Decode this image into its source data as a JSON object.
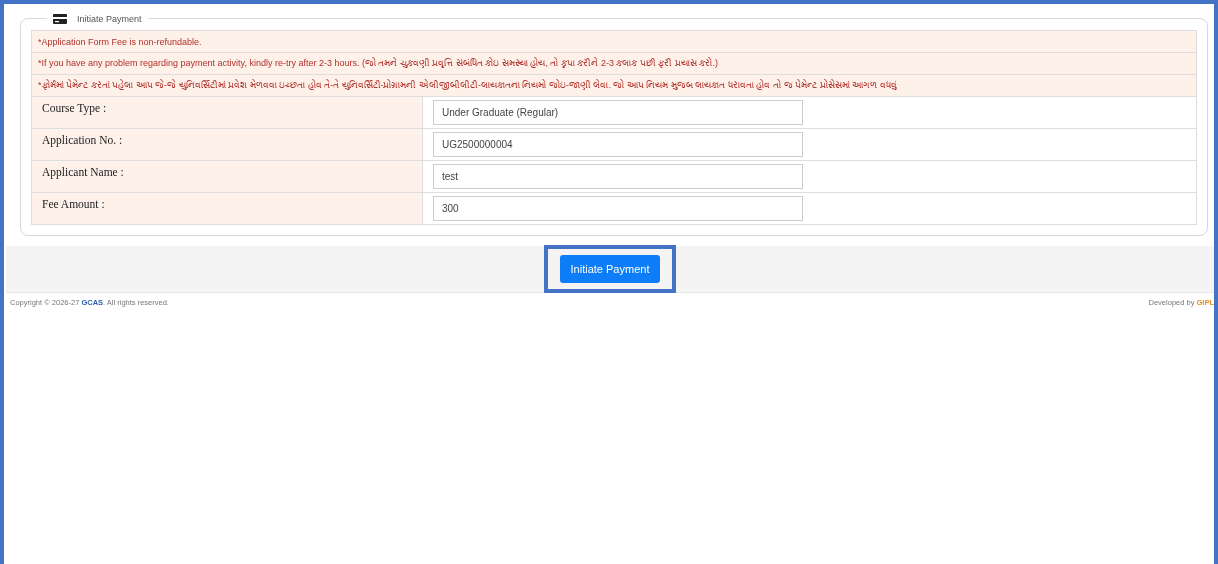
{
  "panel": {
    "title": "Initiate Payment"
  },
  "notices": [
    "*Application Form Fee is non-refundable.",
    "*If you have any problem regarding payment activity, kindly re-try after 2-3 hours. (જો તમને ચુકવણી પ્રવૃત્તિ સંબંધિત કોઇ સમસ્યા હોય, તો કૃપા કરીને 2-3 કલાક પછી ફરી પ્રયાસ કરો.)",
    "*ફોર્મમાં પેમેન્ટ કરતાં પહેલા આપ જે-જે યુનિવર્સિટીમાં પ્રવેશ મેળવવા ઇચ્છતા હોવ તે-તે યુનિવર્સિટી-પ્રોગ્રામની એલીજીબીલીટી-લાયકાતના નિયમો જોઇ-જાણી લેવા. જો આપ નિયમ મુજબ લાયકાત ધરાવતા હોવ તો જ પેમેન્ટ પ્રોસેસમાં આગળ વધવું"
  ],
  "fields": [
    {
      "label": "Course Type :",
      "value": "Under Graduate (Regular)"
    },
    {
      "label": "Application No. :",
      "value": "UG2500000004"
    },
    {
      "label": "Applicant Name :",
      "value": "test"
    },
    {
      "label": "Fee Amount :",
      "value": "300"
    }
  ],
  "button": {
    "label": "Initiate Payment"
  },
  "footer": {
    "copyright": "Copyright © 2026-27 **GCAS**. All rights reserved.",
    "developed_by": "Developed by **GIPL**"
  }
}
